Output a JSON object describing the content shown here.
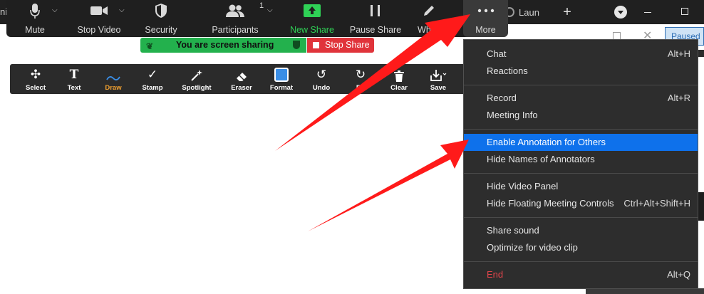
{
  "os": {
    "left_text": "ni",
    "browser_tab_label": "Laun"
  },
  "toolbar": {
    "mute": "Mute",
    "stop_video": "Stop Video",
    "security": "Security",
    "participants": "Participants",
    "participants_count": "1",
    "new_share": "New Share",
    "pause_share": "Pause Share",
    "whiteboard": "White",
    "more": "More"
  },
  "banner": {
    "sharing": "You are screen sharing",
    "stop_share": "Stop Share"
  },
  "annotation": {
    "tools": [
      "Select",
      "Text",
      "Draw",
      "Stamp",
      "Spotlight",
      "Eraser",
      "Format",
      "Undo",
      "Re",
      "Clear",
      "Save"
    ]
  },
  "menu": {
    "items": [
      {
        "label": "Chat",
        "shortcut": "Alt+H"
      },
      {
        "label": "Reactions",
        "shortcut": ""
      },
      {
        "label": "Record",
        "shortcut": "Alt+R"
      },
      {
        "label": "Meeting Info",
        "shortcut": ""
      },
      {
        "label": "Enable Annotation for Others",
        "shortcut": ""
      },
      {
        "label": "Hide Names of Annotators",
        "shortcut": ""
      },
      {
        "label": "Hide Video Panel",
        "shortcut": ""
      },
      {
        "label": "Hide Floating Meeting Controls",
        "shortcut": "Ctrl+Alt+Shift+H"
      },
      {
        "label": "Share sound",
        "shortcut": ""
      },
      {
        "label": "Optimize for video clip",
        "shortcut": ""
      },
      {
        "label": "End",
        "shortcut": "Alt+Q"
      }
    ]
  },
  "background": {
    "paused_label": "Paused"
  },
  "colors": {
    "accent_green": "#2fd156",
    "highlight_blue": "#0e71eb",
    "stop_red": "#e0343b",
    "end_red": "#e0444a",
    "arrow_red": "#ff1a1a",
    "draw_orange": "#f0a030"
  }
}
